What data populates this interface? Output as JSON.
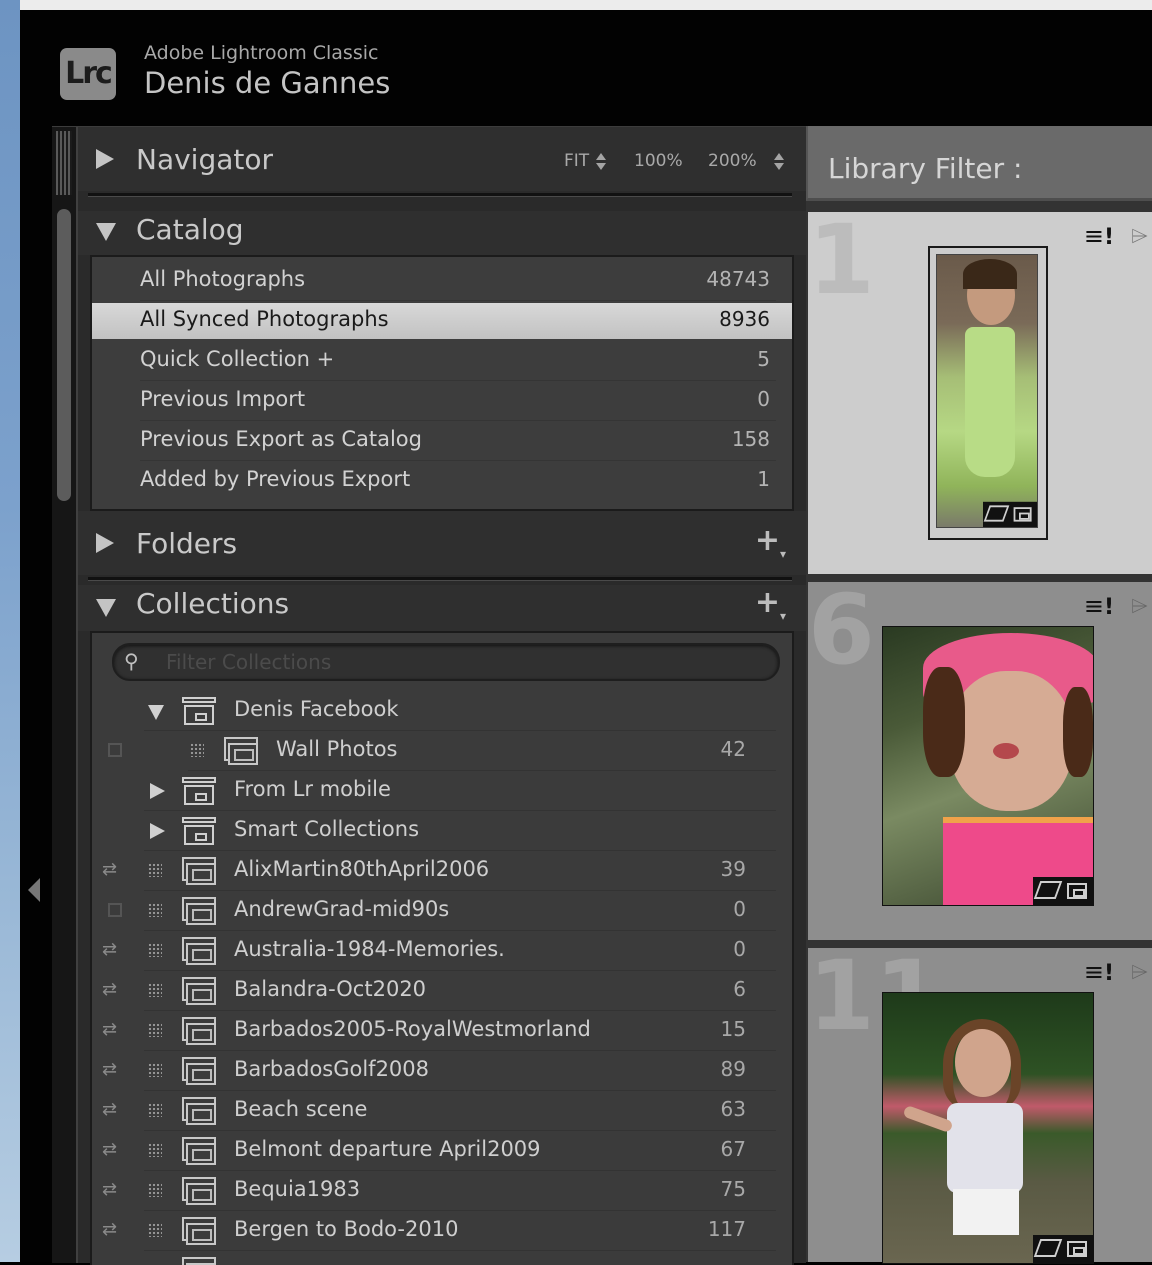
{
  "identity": {
    "logo": "Lrc",
    "app_name": "Adobe Lightroom Classic",
    "user_name": "Denis de Gannes"
  },
  "navigator": {
    "title": "Navigator",
    "zoom_fit": "FIT",
    "zoom_100": "100%",
    "zoom_200": "200%"
  },
  "catalog": {
    "title": "Catalog",
    "items": [
      {
        "label": "All Photographs",
        "count": "48743"
      },
      {
        "label": "All Synced Photographs",
        "count": "8936"
      },
      {
        "label": "Quick Collection  +",
        "count": "5"
      },
      {
        "label": "Previous Import",
        "count": "0"
      },
      {
        "label": "Previous Export as Catalog",
        "count": "158"
      },
      {
        "label": "Added by Previous Export",
        "count": "1"
      }
    ]
  },
  "folders": {
    "title": "Folders"
  },
  "collections": {
    "title": "Collections",
    "filter_placeholder": "Filter Collections",
    "sets": [
      {
        "label": "Denis Facebook"
      },
      {
        "label": "From Lr mobile"
      },
      {
        "label": "Smart Collections"
      }
    ],
    "child": {
      "label": "Wall Photos",
      "count": "42"
    },
    "items": [
      {
        "label": "AlixMartin80thApril2006",
        "count": "39"
      },
      {
        "label": "AndrewGrad-mid90s",
        "count": "0"
      },
      {
        "label": "Australia-1984-Memories.",
        "count": "0"
      },
      {
        "label": "Balandra-Oct2020",
        "count": "6"
      },
      {
        "label": "Barbados2005-RoyalWestmorland",
        "count": "15"
      },
      {
        "label": "BarbadosGolf2008",
        "count": "89"
      },
      {
        "label": "Beach scene",
        "count": "63"
      },
      {
        "label": "Belmont departure April2009",
        "count": "67"
      },
      {
        "label": "Bequia1983",
        "count": "75"
      },
      {
        "label": "Bergen to Bodo-2010",
        "count": "117"
      }
    ]
  },
  "library_filter": {
    "label": "Library Filter :"
  },
  "grid": {
    "cells": [
      {
        "index": "1"
      },
      {
        "index": "6"
      },
      {
        "index": "11"
      }
    ]
  },
  "icons": {
    "collapse_left": "triangle-left-icon",
    "panel_add": "plus-icon",
    "cell_menu": "menu-icon",
    "cell_badge": "metadata-icon"
  }
}
